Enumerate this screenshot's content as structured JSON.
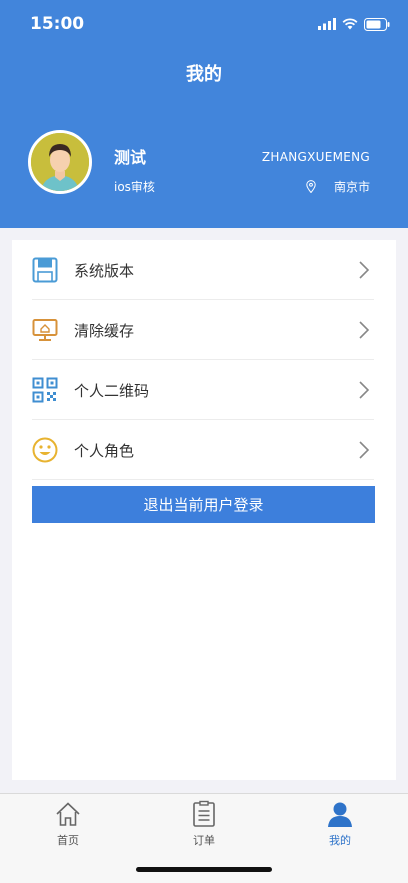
{
  "status": {
    "time": "15:00"
  },
  "header": {
    "title": "我的"
  },
  "profile": {
    "name": "测试",
    "role": "ios审核",
    "account": "ZHANGXUEMENG",
    "city": "南京市"
  },
  "menu": {
    "items": [
      {
        "label": "系统版本",
        "icon": "floppy-disk-icon"
      },
      {
        "label": "清除缓存",
        "icon": "monitor-icon"
      },
      {
        "label": "个人二维码",
        "icon": "qr-code-icon"
      },
      {
        "label": "个人角色",
        "icon": "smiley-icon"
      }
    ]
  },
  "logout": {
    "label": "退出当前用户登录"
  },
  "tabbar": {
    "tabs": [
      {
        "label": "首页",
        "icon": "home-icon"
      },
      {
        "label": "订单",
        "icon": "clipboard-icon"
      },
      {
        "label": "我的",
        "icon": "user-icon",
        "active": true
      }
    ]
  },
  "colors": {
    "primary": "#4285DB",
    "active_tab": "#2E73C9"
  }
}
